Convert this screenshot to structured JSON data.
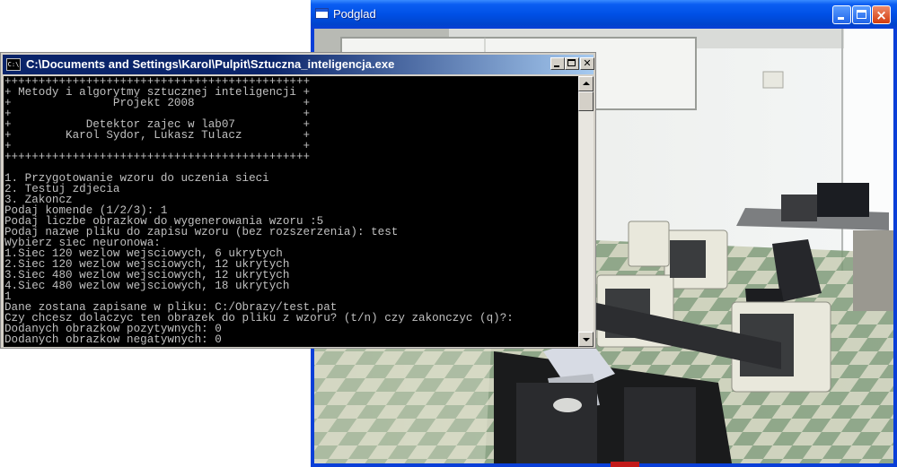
{
  "preview_window": {
    "title": "Podglad",
    "icon": "window-app-icon"
  },
  "console_window": {
    "title": "C:\\Documents and Settings\\Karol\\Pulpit\\Sztuczna_inteligencja.exe",
    "icon_label": "C:\\",
    "lines": [
      "+++++++++++++++++++++++++++++++++++++++++++++",
      "+ Metody i algorytmy sztucznej inteligencji +",
      "+               Projekt 2008                +",
      "+                                           +",
      "+           Detektor zajec w lab07          +",
      "+        Karol Sydor, Lukasz Tulacz         +",
      "+                                           +",
      "+++++++++++++++++++++++++++++++++++++++++++++",
      "",
      "1. Przygotowanie wzoru do uczenia sieci",
      "2. Testuj zdjecia",
      "3. Zakoncz",
      "Podaj komende (1/2/3): 1",
      "Podaj liczbe obrazkow do wygenerowania wzoru :5",
      "Podaj nazwe pliku do zapisu wzoru (bez rozszerzenia): test",
      "Wybierz siec neuronowa:",
      "1.Siec 120 wezlow wejsciowych, 6 ukrytych",
      "2.Siec 120 wezlow wejsciowych, 12 ukrytych",
      "3.Siec 480 wezlow wejsciowych, 12 ukrytych",
      "4.Siec 480 wezlow wejsciowych, 18 ukrytych",
      "1",
      "Dane zostana zapisane w pliku: C:/Obrazy/test.pat",
      "Czy chcesz dolaczyc ten obrazek do pliku z wzoru? (t/n) czy zakonczyc (q)?:",
      "Dodanych obrazkow pozytywnych: 0",
      "Dodanych obrazkow negatywnych: 0"
    ]
  },
  "colors": {
    "console_bg": "#000000",
    "console_text": "#c0c0c0",
    "console_title_active": "#0a246a",
    "xp_title_blue": "#0050e6",
    "xp_close_red": "#d23c0e"
  }
}
